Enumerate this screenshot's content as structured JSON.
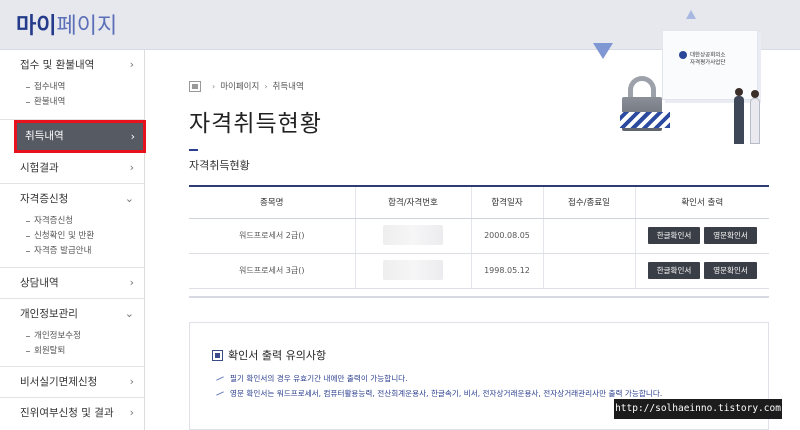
{
  "header": {
    "title_part1": "마이",
    "title_part2": "페이지"
  },
  "sidebar": {
    "groups": [
      {
        "label": "접수 및 환불내역",
        "chevron": "›",
        "subs": [
          "접수내역",
          "환불내역"
        ]
      },
      {
        "label": "취득내역",
        "chevron": "›",
        "active": true
      },
      {
        "label": "시험결과",
        "chevron": "›"
      },
      {
        "label": "자격증신청",
        "chevron": "⌄",
        "subs": [
          "자격증신청",
          "신청확인 및 반환",
          "자격증 발급안내"
        ]
      },
      {
        "label": "상담내역",
        "chevron": "›"
      },
      {
        "label": "개인정보관리",
        "chevron": "⌄",
        "subs": [
          "개인정보수정",
          "회원탈퇴"
        ]
      },
      {
        "label": "비서실기면제신청",
        "chevron": "›"
      },
      {
        "label": "진위여부신청 및 결과",
        "chevron": "›"
      }
    ]
  },
  "decoration": {
    "monitor_text_line1": "대한상공회의소",
    "monitor_text_line2": "자격평가사업단"
  },
  "breadcrumb": {
    "items": [
      "마이페이지",
      "취득내역"
    ],
    "separator": "›"
  },
  "page": {
    "title": "자격취득현황",
    "section_title": "자격취득현황"
  },
  "table": {
    "headers": [
      "종목명",
      "합격/자격번호",
      "합격일자",
      "접수/종료일",
      "확인서 출력"
    ],
    "rows": [
      {
        "name": "워드프로세서 2급()",
        "date": "2000.08.05",
        "period": "",
        "btn_kr": "한글확인서",
        "btn_en": "영문확인서"
      },
      {
        "name": "워드프로세서 3급()",
        "date": "1998.05.12",
        "period": "",
        "btn_kr": "한글확인서",
        "btn_en": "영문확인서"
      }
    ]
  },
  "notice": {
    "title": "확인서 출력 유의사항",
    "items": [
      "필기 확인서의 경우 유효기간 내에만 출력이 가능합니다.",
      "영문 확인서는 워드프로세서, 컴퓨터활용능력, 전산회계운용사, 한글속기, 비서, 전자상거래운용사, 전자상거래관리사만 출력 가능합니다."
    ]
  },
  "watermark": "http://solhaeinno.tistory.com",
  "colors": {
    "brand": "#243a8a",
    "active_bg": "#555a63",
    "active_border": "#e8121c",
    "button": "#3a3e46"
  }
}
